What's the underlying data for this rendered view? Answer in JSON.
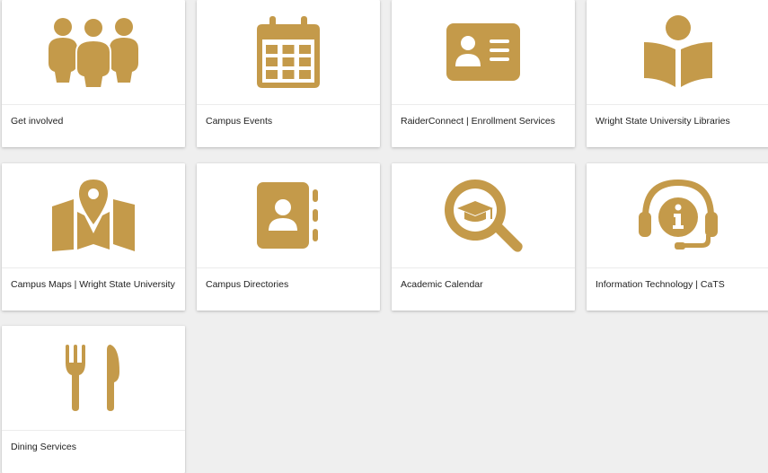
{
  "tiles": [
    {
      "label": "Get involved",
      "icon": "group-people-icon"
    },
    {
      "label": "Campus Events",
      "icon": "calendar-icon"
    },
    {
      "label": "RaiderConnect | Enrollment Services",
      "icon": "id-card-icon"
    },
    {
      "label": "Wright State University Libraries",
      "icon": "reader-book-icon"
    },
    {
      "label": "Campus Maps | Wright State University",
      "icon": "map-pin-icon"
    },
    {
      "label": "Campus Directories",
      "icon": "address-book-icon"
    },
    {
      "label": "Academic Calendar",
      "icon": "search-graduation-cap-icon"
    },
    {
      "label": "Information Technology | CaTS",
      "icon": "headset-info-icon"
    },
    {
      "label": "Dining Services",
      "icon": "fork-knife-icon"
    }
  ],
  "colors": {
    "icon": "#c49a4a",
    "background": "#efefef",
    "card": "#ffffff"
  }
}
